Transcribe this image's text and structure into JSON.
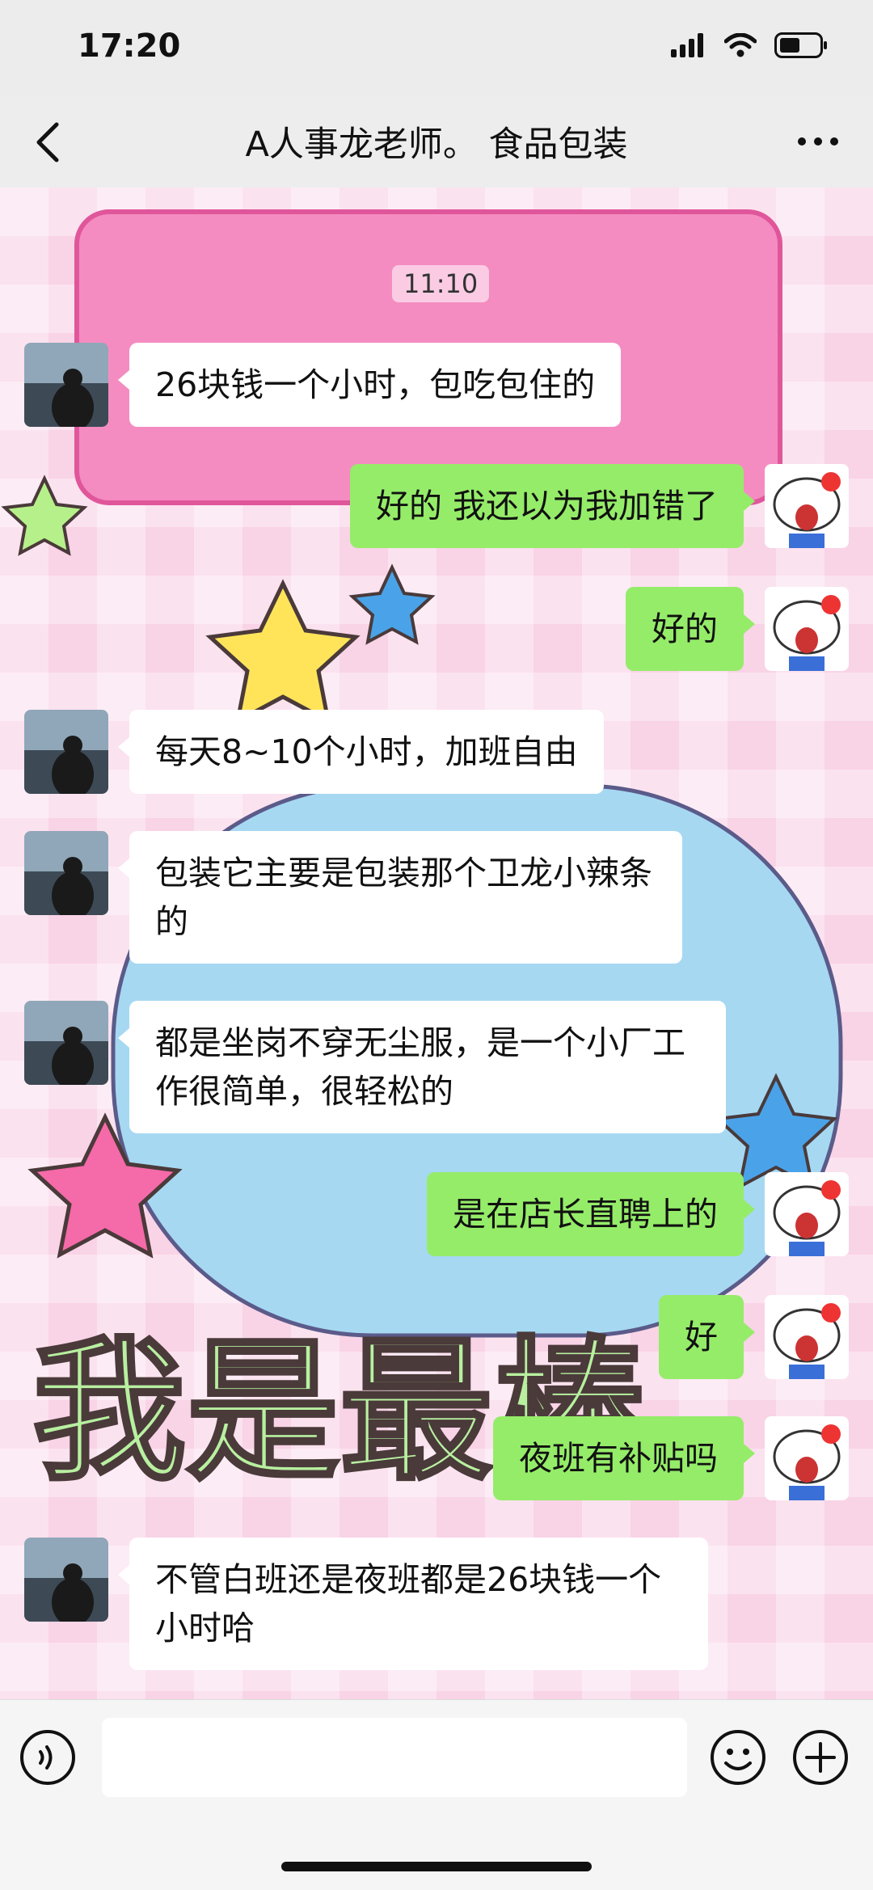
{
  "status": {
    "time": "17:20"
  },
  "nav": {
    "title": "A人事龙老师。 食品包装"
  },
  "chat": {
    "timestamp": "11:10",
    "messages": [
      {
        "side": "left",
        "text": "26块钱一个小时，包吃包住的"
      },
      {
        "side": "right",
        "text": "好的 我还以为我加错了"
      },
      {
        "side": "right",
        "text": "好的"
      },
      {
        "side": "left",
        "text": "每天8~10个小时，加班自由"
      },
      {
        "side": "left",
        "text": "包装它主要是包装那个卫龙小辣条的"
      },
      {
        "side": "left",
        "text": "都是坐岗不穿无尘服，是一个小厂工作很简单，很轻松的"
      },
      {
        "side": "right",
        "text": "是在店长直聘上的"
      },
      {
        "side": "right",
        "text": "好"
      },
      {
        "side": "right",
        "text": "夜班有补贴吗"
      },
      {
        "side": "left",
        "text": "不管白班还是夜班都是26块钱一个小时哈"
      }
    ]
  },
  "colors": {
    "bubble_self": "#95ec69",
    "bubble_other": "#ffffff",
    "chat_bg": "#f9d3e6"
  },
  "icons": [
    "back-icon",
    "more-icon",
    "voice-icon",
    "emoji-icon",
    "plus-icon",
    "signal-icon",
    "wifi-icon",
    "battery-icon"
  ]
}
